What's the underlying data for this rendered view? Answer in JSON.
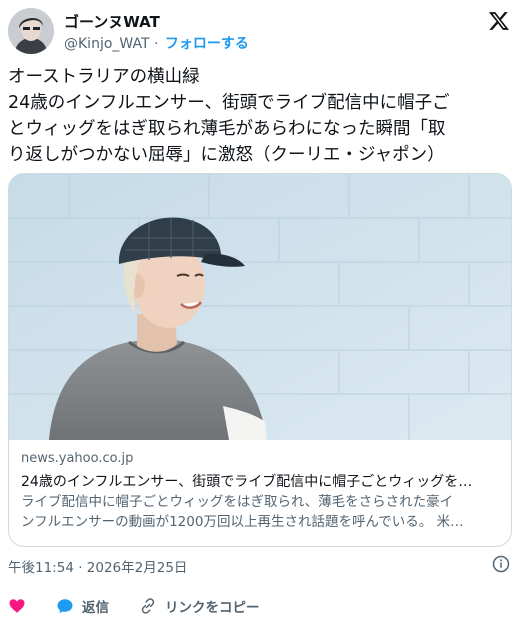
{
  "user": {
    "display_name": "ゴーンヌWAT",
    "handle": "@Kinjo_WAT",
    "separator": "·",
    "follow_label": "フォローする"
  },
  "tweet": {
    "lines": [
      "オーストラリアの横山緑",
      "24歳のインフルエンサー、街頭でライブ配信中に帽子ご",
      "とウィッグをはぎ取られ薄毛があらわになった瞬間「取",
      "り返しがつかない屈辱」に激怒（クーリエ・ジャポン）"
    ]
  },
  "card": {
    "domain": "news.yahoo.co.jp",
    "title": "24歳のインフルエンサー、街頭でライブ配信中に帽子ごとウィッグを…",
    "description_lines": [
      "ライブ配信中に帽子ごとウィッグをはぎ取られ、薄毛をさらされた豪イ",
      "ンフルエンサーの動画が1200万回以上再生され話題を呼んでいる。 米…"
    ]
  },
  "meta": {
    "timestamp": "午後11:54 · 2026年2月25日"
  },
  "actions": {
    "reply_label": "返信",
    "copy_link_label": "リンクをコピー"
  },
  "icons": {
    "brand": "x-logo-icon",
    "like": "heart-icon",
    "reply": "speech-bubble-icon",
    "link": "link-icon",
    "info": "info-icon"
  },
  "colors": {
    "accent": "#1d9bf0",
    "like": "#f91880",
    "text": "#0f1419",
    "muted": "#536471",
    "border": "#cfd9de"
  }
}
